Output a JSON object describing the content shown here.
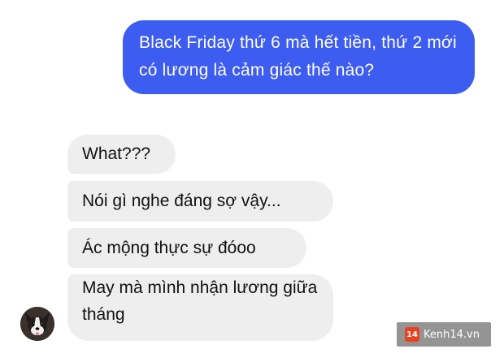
{
  "messages": {
    "sent": [
      {
        "text": "Black Friday thứ 6 mà hết tiền, thứ 2 mới có lương là cảm giác thế nào?"
      }
    ],
    "received": [
      {
        "text": "What???"
      },
      {
        "text": "Nói gì nghe đáng sợ vậy..."
      },
      {
        "text": "Ác mộng thực sự đóoo"
      },
      {
        "text": "May mà mình nhận lương giữa tháng"
      }
    ]
  },
  "colors": {
    "sent_bubble": "#3d5cf0",
    "received_bubble": "#eeeeef",
    "watermark_logo": "#e8411f"
  },
  "avatar": {
    "icon": "dog-avatar-icon"
  },
  "watermark": {
    "logo_text": "14",
    "text": "Kenh14.vn"
  }
}
